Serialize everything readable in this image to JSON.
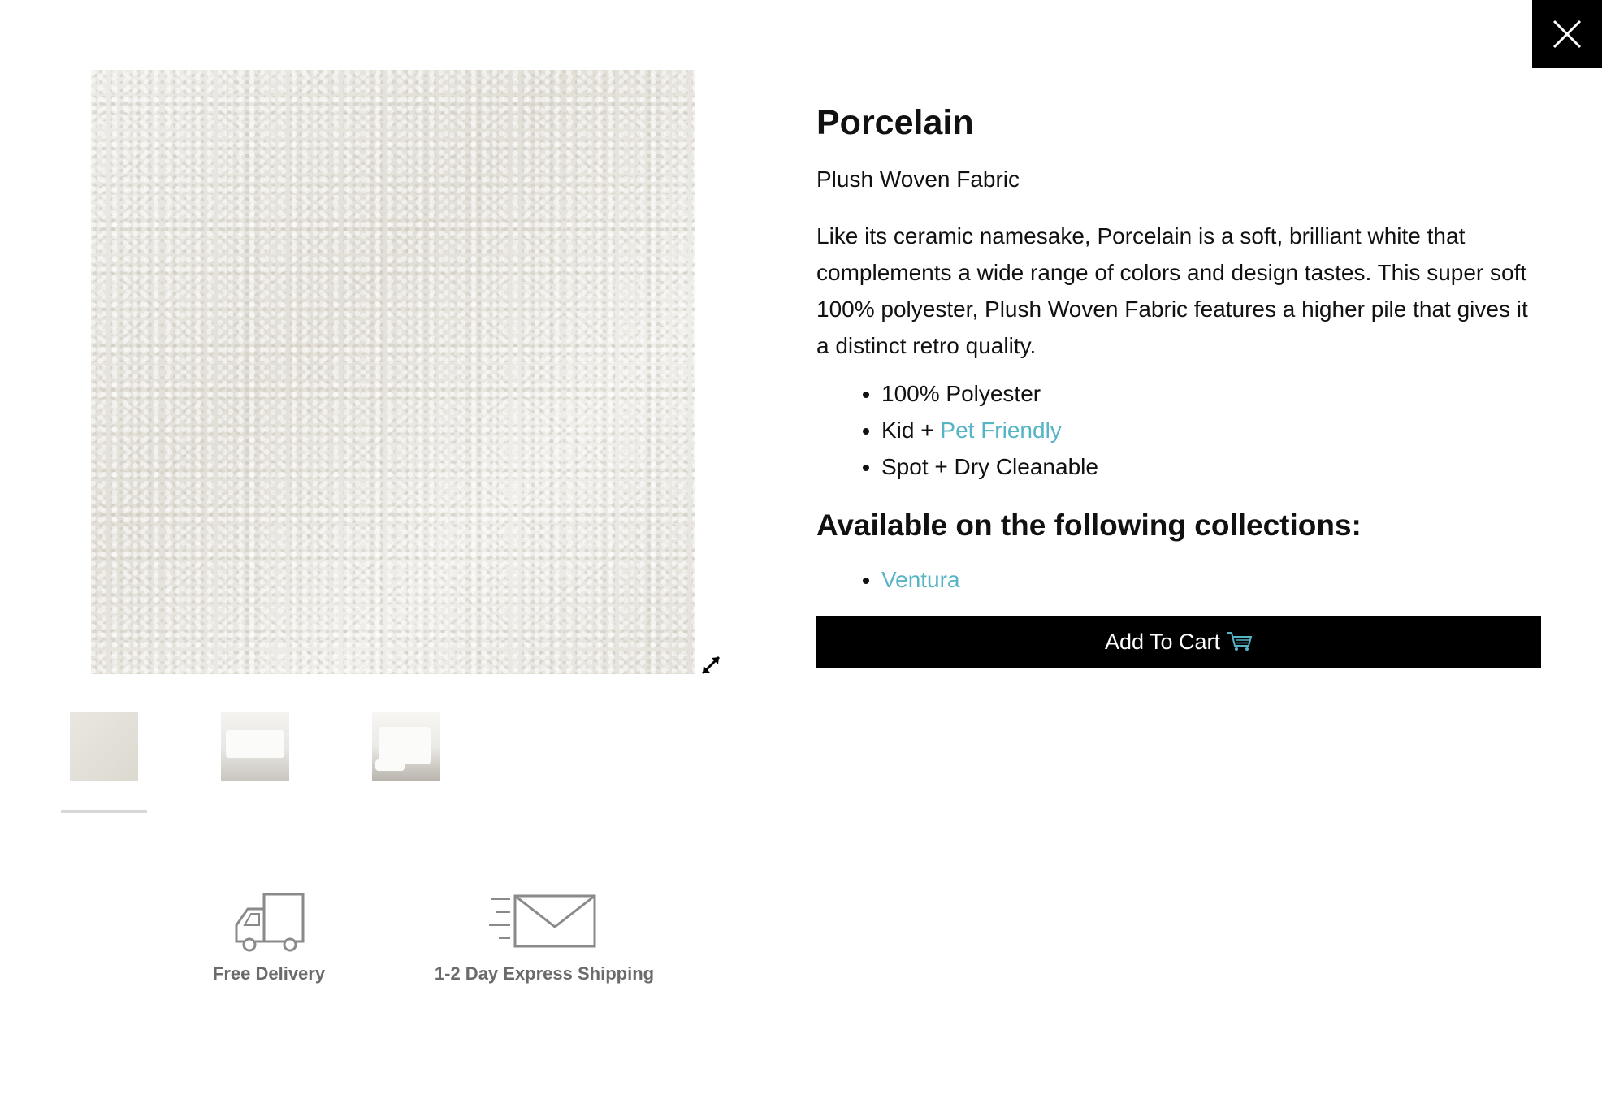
{
  "product": {
    "title": "Porcelain",
    "subtitle": "Plush Woven Fabric",
    "description": "Like its ceramic namesake, Porcelain is a soft, brilliant white that complements a wide range of colors and design tastes. This super soft 100% polyester, Plush Woven Fabric features a higher pile that gives it a distinct retro quality.",
    "features": {
      "item1": "100% Polyester",
      "item2_prefix": "Kid + ",
      "item2_link": "Pet Friendly",
      "item3": "Spot + Dry Cleanable"
    },
    "collections_heading": "Available on the following collections:",
    "collections": [
      "Ventura"
    ],
    "add_to_cart_label": "Add To Cart"
  },
  "gallery": {
    "main_image": "fabric-swatch-image",
    "thumbnails": [
      "fabric-swatch-thumb",
      "sofa-thumb",
      "recliner-thumb"
    ],
    "selected_index": 0
  },
  "features_bar": {
    "delivery_label": "Free Delivery",
    "shipping_label": "1-2 Day Express Shipping"
  },
  "colors": {
    "accent": "#56b4c4",
    "button_bg": "#000000",
    "icon_gray": "#8a8a8a"
  },
  "icons": {
    "close": "close-icon",
    "expand": "expand-icon",
    "cart": "cart-icon",
    "truck": "truck-icon",
    "envelope": "envelope-icon"
  }
}
